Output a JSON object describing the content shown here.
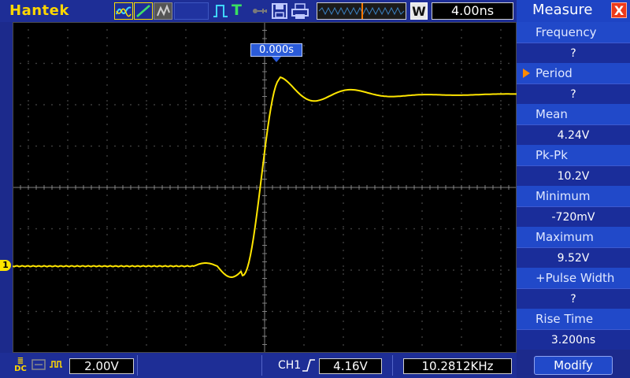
{
  "brand": "Hantek",
  "timebase": "4.00ns",
  "mode_button": "W",
  "trigger_time_tag": "0.000s",
  "channel_marker": "1",
  "bottom": {
    "coupling_lines": [
      "≣",
      "DC"
    ],
    "volts_per_div": "2.00V",
    "trigger_source": "CH1",
    "trigger_level": "4.16V",
    "frequency": "10.2812KHz"
  },
  "panel": {
    "title": "Measure",
    "close": "X",
    "selected": "Period",
    "measurements": [
      {
        "label": "Frequency",
        "value": "?"
      },
      {
        "label": "Period",
        "value": "?"
      },
      {
        "label": "Mean",
        "value": "4.24V"
      },
      {
        "label": "Pk-Pk",
        "value": "10.2V"
      },
      {
        "label": "Minimum",
        "value": "-720mV"
      },
      {
        "label": "Maximum",
        "value": "9.52V"
      },
      {
        "label": "+Pulse Width",
        "value": "?"
      },
      {
        "label": "Rise Time",
        "value": "3.200ns"
      }
    ],
    "modify_label": "Modify"
  },
  "colors": {
    "trace": "#ffe600",
    "background": "#000000",
    "chrome": "#1c2a8c",
    "grid": "#5a5a5a"
  }
}
